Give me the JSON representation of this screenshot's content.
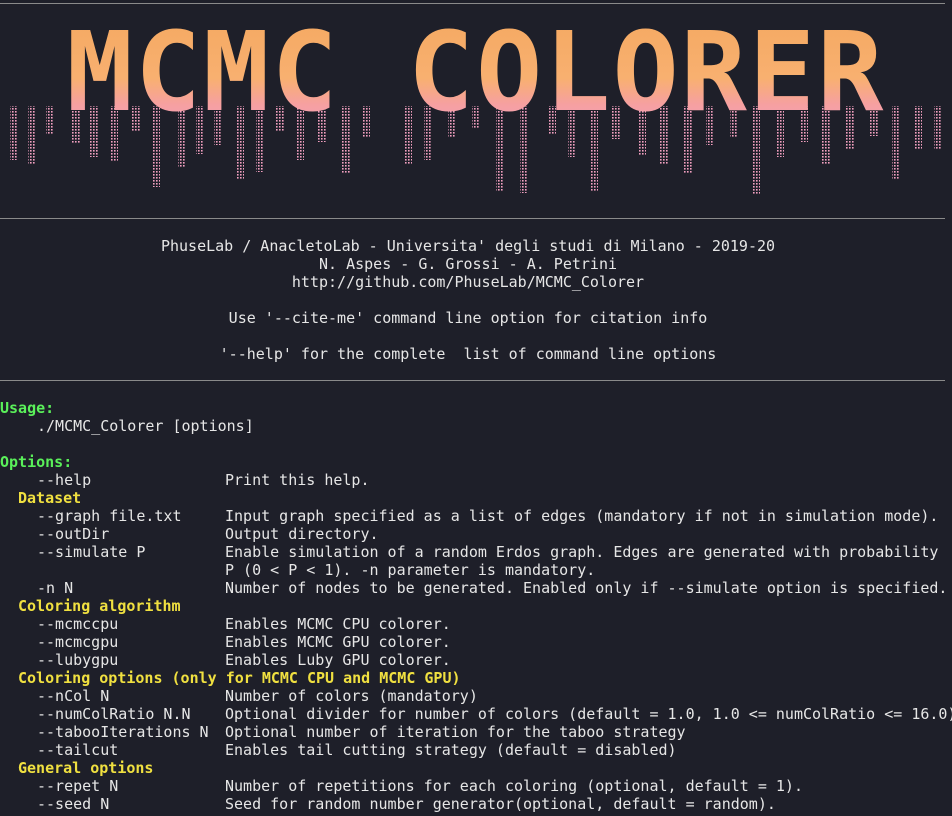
{
  "banner": {
    "text": "MCMC COLORER",
    "colors": [
      "#f4a860",
      "#f8b070",
      "#f6a0a0",
      "#f2a0c0"
    ]
  },
  "credits": {
    "lab": "PhuseLab / AnacletoLab - Universita' degli studi di Milano - 2019-20",
    "authors": "N. Aspes - G. Grossi - A. Petrini",
    "url": "http://github.com/PhuseLab/MCMC_Colorer",
    "cite": "Use '--cite-me' command line option for citation info",
    "help": "'--help' for the complete  list of command line options"
  },
  "usage": {
    "heading": "Usage:",
    "command": "./MCMC_Colorer [options]"
  },
  "options_heading": "Options:",
  "help_option": {
    "flag": "--help",
    "desc": "Print this help."
  },
  "sections": [
    {
      "title": "Dataset",
      "rows": [
        {
          "flag": "--graph file.txt",
          "desc": "Input graph specified as a list of edges (mandatory if not in simulation mode)."
        },
        {
          "flag": "--outDir",
          "desc": "Output directory."
        },
        {
          "flag": "--simulate P",
          "desc": "Enable simulation of a random Erdos graph. Edges are generated with probability",
          "desc2": "P (0 < P < 1). -n parameter is mandatory."
        },
        {
          "flag": "-n N",
          "desc": "Number of nodes to be generated. Enabled only if --simulate option is specified."
        }
      ]
    },
    {
      "title": "Coloring algorithm",
      "rows": [
        {
          "flag": "--mcmccpu",
          "desc": "Enables MCMC CPU colorer."
        },
        {
          "flag": "--mcmcgpu",
          "desc": "Enables MCMC GPU colorer."
        },
        {
          "flag": "--lubygpu",
          "desc": "Enables Luby GPU colorer."
        }
      ]
    },
    {
      "title": "Coloring options (only for MCMC CPU and MCMC GPU)",
      "rows": [
        {
          "flag": "--nCol N",
          "desc": "Number of colors (mandatory)"
        },
        {
          "flag": "--numColRatio N.N",
          "desc": "Optional divider for number of colors (default = 1.0, 1.0 <= numColRatio <= 16.0)"
        },
        {
          "flag": "--tabooIterations N",
          "desc": "Optional number of iteration for the taboo strategy"
        },
        {
          "flag": "--tailcut",
          "desc": "Enables tail cutting strategy (default = disabled)"
        }
      ]
    },
    {
      "title": "General options",
      "rows": [
        {
          "flag": "--repet N",
          "desc": "Number of repetitions for each coloring (optional, default = 1)."
        },
        {
          "flag": "--seed N",
          "desc": "Seed for random number generator(optional, default = random)."
        }
      ]
    }
  ]
}
